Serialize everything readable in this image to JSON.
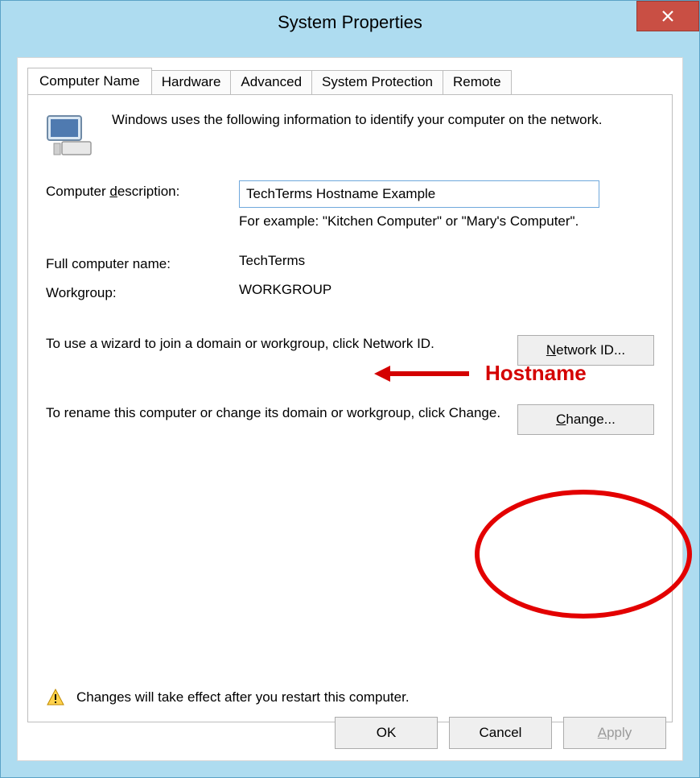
{
  "window": {
    "title": "System Properties",
    "close_icon": "close-icon"
  },
  "tabs": [
    {
      "label": "Computer Name",
      "active": true
    },
    {
      "label": "Hardware",
      "active": false
    },
    {
      "label": "Advanced",
      "active": false
    },
    {
      "label": "System Protection",
      "active": false
    },
    {
      "label": "Remote",
      "active": false
    }
  ],
  "intro_text": "Windows uses the following information to identify your computer on the network.",
  "description": {
    "label": "Computer description:",
    "label_underline_char": "d",
    "value": "TechTerms Hostname Example",
    "example": "For example: \"Kitchen Computer\" or \"Mary's Computer\"."
  },
  "full_name": {
    "label": "Full computer name:",
    "value": "TechTerms"
  },
  "workgroup": {
    "label": "Workgroup:",
    "value": "WORKGROUP"
  },
  "network_id": {
    "text": "To use a wizard to join a domain or workgroup, click Network ID.",
    "button": "Network ID...",
    "button_underline_char": "N"
  },
  "change": {
    "text": "To rename this computer or change its domain or workgroup, click Change.",
    "button": "Change...",
    "button_underline_char": "C"
  },
  "warning_text": "Changes will take effect after you restart this computer.",
  "buttons": {
    "ok": "OK",
    "cancel": "Cancel",
    "apply": "Apply",
    "apply_underline_char": "A",
    "apply_disabled": true
  },
  "annotation": {
    "hostname_label": "Hostname"
  }
}
